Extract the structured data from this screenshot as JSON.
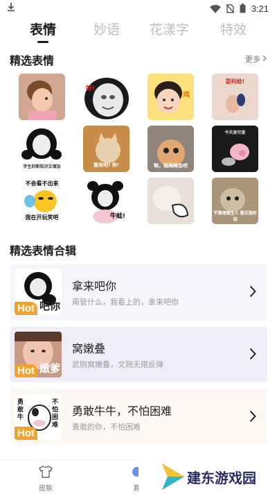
{
  "status_bar": {
    "time": "3:21"
  },
  "tabs": [
    {
      "label": "表情"
    },
    {
      "label": "妙语"
    },
    {
      "label": "花漾字"
    },
    {
      "label": "特效"
    }
  ],
  "featured": {
    "title": "精选表情",
    "more_label": "更多"
  },
  "stickers": [
    {
      "name": "toddler-girl-sticker",
      "caption": ""
    },
    {
      "name": "panda-face-sticker",
      "caption": "好!"
    },
    {
      "name": "cute-kid-sticker",
      "caption": "鸡"
    },
    {
      "name": "hand-sticker",
      "caption": "耍利给!"
    },
    {
      "name": "panda-meme-sticker",
      "caption": "学生的新知识又增加"
    },
    {
      "name": "cat-sticker",
      "caption": "要来吧! 你!"
    },
    {
      "name": "kitten-sticker",
      "caption": "啊，我再睡会吧"
    },
    {
      "name": "pig-sticker",
      "caption": "今天更可爱"
    },
    {
      "name": "emoji-hand-sticker",
      "caption_top": "不会看不出来",
      "caption_bottom": "我在开玩笑吧"
    },
    {
      "name": "panda-bow-sticker",
      "caption": "牛蛙!"
    },
    {
      "name": "white-cat-sticker",
      "caption": ""
    },
    {
      "name": "cat-meme-sticker",
      "caption": "不想理随生人 看见我的泪"
    }
  ],
  "collections": {
    "title": "精选表情合辑",
    "items": [
      {
        "title": "拿来吧你",
        "subtitle": "甭管什么，我看上的，拿来吧你",
        "badge": "Hot",
        "thumb_caption": "吧你",
        "bg": "#f4f6fc"
      },
      {
        "title": "窝嫩叠",
        "subtitle": "武则窝嫩叠，文则无限反弹",
        "badge": "Hot",
        "thumb_caption": "嫩爹",
        "bg": "#efeef8"
      },
      {
        "title": "勇敢牛牛，不怕困难",
        "subtitle": "勇敢的你，不怕困难",
        "badge": "Hot",
        "thumb_caption": "",
        "bg": "#fdf9f2"
      }
    ]
  },
  "bottom_nav": [
    {
      "label": "皮肤"
    },
    {
      "label": "趣"
    }
  ],
  "watermark": {
    "text": "建东游戏园"
  }
}
